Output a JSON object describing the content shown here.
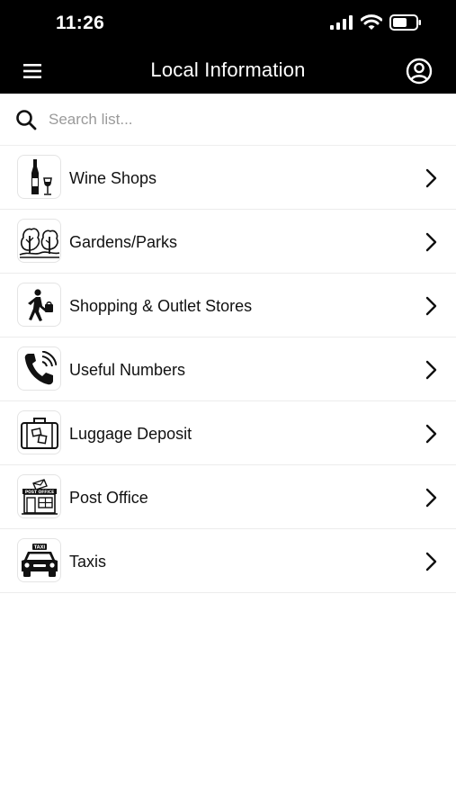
{
  "status": {
    "time": "11:26"
  },
  "header": {
    "title": "Local Information"
  },
  "search": {
    "placeholder": "Search list..."
  },
  "items": [
    {
      "label": "Wine Shops",
      "icon": "wine-icon"
    },
    {
      "label": "Gardens/Parks",
      "icon": "trees-icon"
    },
    {
      "label": "Shopping & Outlet Stores",
      "icon": "shopper-icon"
    },
    {
      "label": "Useful Numbers",
      "icon": "phone-icon"
    },
    {
      "label": "Luggage Deposit",
      "icon": "suitcase-icon"
    },
    {
      "label": "Post Office",
      "icon": "post-office-icon"
    },
    {
      "label": "Taxis",
      "icon": "taxi-icon"
    }
  ],
  "icon_text": {
    "post_office_sign": "POST OFFICE",
    "taxi_sign": "TAXI"
  },
  "colors": {
    "bar_background": "#000000",
    "bar_text": "#ffffff",
    "divider": "#ececec"
  }
}
